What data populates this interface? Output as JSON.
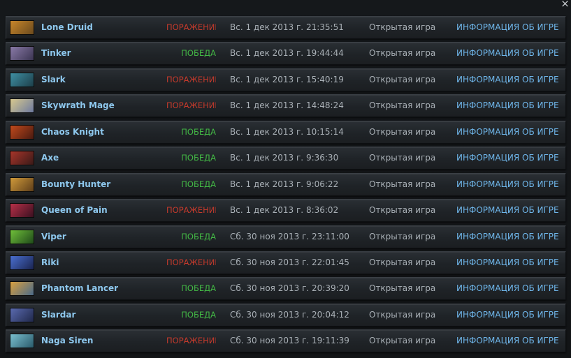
{
  "window": {
    "close_glyph": "×"
  },
  "columns": {
    "info_label": "ИНФОРМАЦИЯ ОБ ИГРЕ",
    "mode_label": "Открытая игра"
  },
  "matches": [
    {
      "hero": "Lone Druid",
      "result": "ПОРАЖЕНИЕ",
      "outcome": "loss",
      "date": "Вс. 1 дек 2013 г. 21:35:51",
      "mode": "Открытая игра",
      "info": "ИНФОРМАЦИЯ ОБ ИГРЕ",
      "portrait_colors": [
        "#c8862a",
        "#6b4a1e"
      ]
    },
    {
      "hero": "Tinker",
      "result": "ПОБЕДА",
      "outcome": "win",
      "date": "Вс. 1 дек 2013 г. 19:44:44",
      "mode": "Открытая игра",
      "info": "ИНФОРМАЦИЯ ОБ ИГРЕ",
      "portrait_colors": [
        "#8a7aa8",
        "#3b3552"
      ]
    },
    {
      "hero": "Slark",
      "result": "ПОРАЖЕНИЕ",
      "outcome": "loss",
      "date": "Вс. 1 дек 2013 г. 15:40:19",
      "mode": "Открытая игра",
      "info": "ИНФОРМАЦИЯ ОБ ИГРЕ",
      "portrait_colors": [
        "#3f8fa3",
        "#1d3f4a"
      ]
    },
    {
      "hero": "Skywrath Mage",
      "result": "ПОРАЖЕНИЕ",
      "outcome": "loss",
      "date": "Вс. 1 дек 2013 г. 14:48:24",
      "mode": "Открытая игра",
      "info": "ИНФОРМАЦИЯ ОБ ИГРЕ",
      "portrait_colors": [
        "#d8c98e",
        "#6d7aa0"
      ]
    },
    {
      "hero": "Chaos Knight",
      "result": "ПОБЕДА",
      "outcome": "win",
      "date": "Вс. 1 дек 2013 г. 10:15:14",
      "mode": "Открытая игра",
      "info": "ИНФОРМАЦИЯ ОБ ИГРЕ",
      "portrait_colors": [
        "#c24a1c",
        "#4a1a10"
      ]
    },
    {
      "hero": "Axe",
      "result": "ПОБЕДА",
      "outcome": "win",
      "date": "Вс. 1 дек 2013 г. 9:36:30",
      "mode": "Открытая игра",
      "info": "ИНФОРМАЦИЯ ОБ ИГРЕ",
      "portrait_colors": [
        "#a8352a",
        "#3a1a18"
      ]
    },
    {
      "hero": "Bounty Hunter",
      "result": "ПОБЕДА",
      "outcome": "win",
      "date": "Вс. 1 дек 2013 г. 9:06:22",
      "mode": "Открытая игра",
      "info": "ИНФОРМАЦИЯ ОБ ИГРЕ",
      "portrait_colors": [
        "#d09a3a",
        "#5e3e1a"
      ]
    },
    {
      "hero": "Queen of Pain",
      "result": "ПОРАЖЕНИЕ",
      "outcome": "loss",
      "date": "Вс. 1 дек 2013 г. 8:36:02",
      "mode": "Открытая игра",
      "info": "ИНФОРМАЦИЯ ОБ ИГРЕ",
      "portrait_colors": [
        "#b83048",
        "#3a1020"
      ]
    },
    {
      "hero": "Viper",
      "result": "ПОБЕДА",
      "outcome": "win",
      "date": "Сб. 30 ноя 2013 г. 23:11:00",
      "mode": "Открытая игра",
      "info": "ИНФОРМАЦИЯ ОБ ИГРЕ",
      "portrait_colors": [
        "#6fbf3a",
        "#1f4a1a"
      ]
    },
    {
      "hero": "Riki",
      "result": "ПОРАЖЕНИЕ",
      "outcome": "loss",
      "date": "Сб. 30 ноя 2013 г. 22:01:45",
      "mode": "Открытая игра",
      "info": "ИНФОРМАЦИЯ ОБ ИГРЕ",
      "portrait_colors": [
        "#4a6fd0",
        "#1a2450"
      ]
    },
    {
      "hero": "Phantom Lancer",
      "result": "ПОБЕДА",
      "outcome": "win",
      "date": "Сб. 30 ноя 2013 г. 20:39:20",
      "mode": "Открытая игра",
      "info": "ИНФОРМАЦИЯ ОБ ИГРЕ",
      "portrait_colors": [
        "#d8a040",
        "#4a6a8a"
      ]
    },
    {
      "hero": "Slardar",
      "result": "ПОБЕДА",
      "outcome": "win",
      "date": "Сб. 30 ноя 2013 г. 20:04:12",
      "mode": "Открытая игра",
      "info": "ИНФОРМАЦИЯ ОБ ИГРЕ",
      "portrait_colors": [
        "#5a6ab0",
        "#20284a"
      ]
    },
    {
      "hero": "Naga Siren",
      "result": "ПОРАЖЕНИЕ",
      "outcome": "loss",
      "date": "Сб. 30 ноя 2013 г. 19:11:39",
      "mode": "Открытая игра",
      "info": "ИНФОРМАЦИЯ ОБ ИГРЕ",
      "portrait_colors": [
        "#7ac0d0",
        "#2a5a6a"
      ]
    }
  ]
}
